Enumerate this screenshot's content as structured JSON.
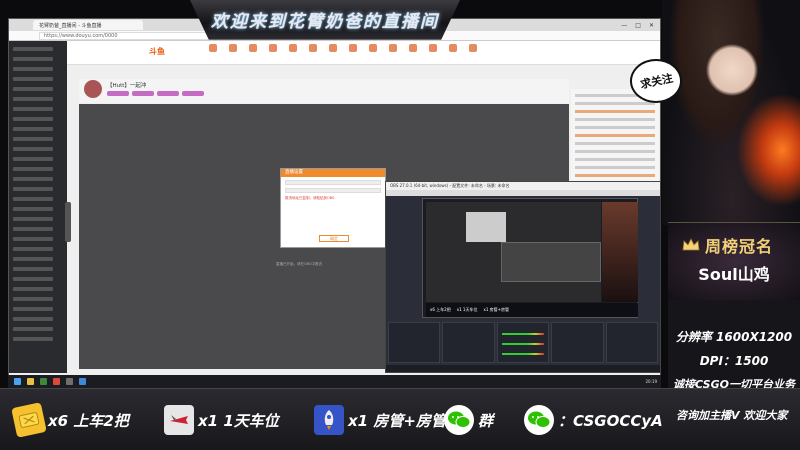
{
  "banner": {
    "title": "欢迎来到花臂奶爸的直播间"
  },
  "browser": {
    "tab_title": "花臂奶爸_直播间 - 斗鱼直播",
    "url": "https://www.douyu.com/0000",
    "site_logo": "斗鱼",
    "stream_title": "【Hutt】一起冲",
    "window_controls": [
      "—",
      "□",
      "✕"
    ]
  },
  "dialog": {
    "title": "直播设置",
    "note": "推流地址已复制，请粘贴到OBS",
    "button_label": "确定"
  },
  "player": {
    "caption": "直播已开始，请在OBS中推流"
  },
  "obs": {
    "title": "OBS 27.0.1 (64-bit, windows) - 配置文件: 未命名 - 场景: 未命名",
    "strip_items": [
      "x6 上车2把",
      "x1 1天车位",
      "x1 房管+房管"
    ]
  },
  "taskbar": {
    "clock": "20:19"
  },
  "bubble": {
    "text": "求关注"
  },
  "crown": {
    "title": "周榜冠名",
    "name": "Soul山鸡"
  },
  "info": {
    "resolution": "分辨率 1600X1200",
    "dpi": "DPI：1500",
    "line1": "诚接CSGO一切平台业务",
    "line2": "咨询加主播V  欢迎大家"
  },
  "bottom": {
    "items": [
      {
        "icon": "ticket-icon",
        "label": "x6 上车2把"
      },
      {
        "icon": "jet-icon",
        "label": "x1 1天车位"
      },
      {
        "icon": "rocket-icon",
        "label": "x1 房管+房管"
      },
      {
        "icon": "wechat-icon",
        "label": "群"
      },
      {
        "icon": "wechat-icon",
        "label": "：CSGOCCyA"
      }
    ]
  },
  "colors": {
    "accent": "#f08a2f",
    "gold": "#f3d27a",
    "panel": "#16161a"
  }
}
